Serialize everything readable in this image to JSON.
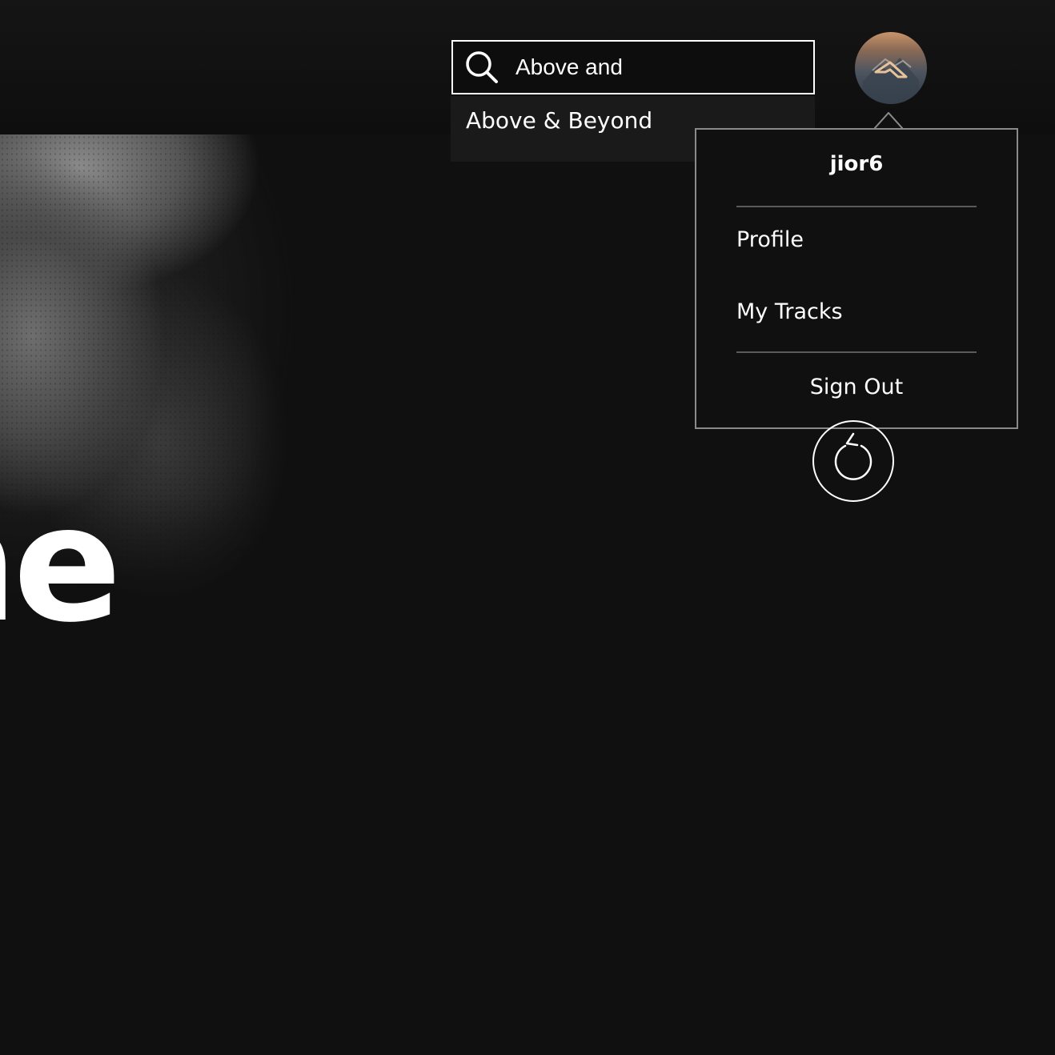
{
  "hero": {
    "title_fragment": "ne"
  },
  "search": {
    "value": "Above and",
    "placeholder": "",
    "suggestions": [
      {
        "label": "Above & Beyond"
      }
    ]
  },
  "user": {
    "avatar_icon": "anjunabeats-logo-icon",
    "menu": {
      "username": "jior6",
      "items": [
        {
          "label": "Profile"
        },
        {
          "label": "My Tracks"
        }
      ],
      "sign_out_label": "Sign Out"
    }
  },
  "controls": {
    "replay_icon": "replay-icon"
  },
  "colors": {
    "background": "#101010",
    "text": "#ffffff",
    "menu_border": "#8a8a8a",
    "divider": "#5a5a5a",
    "suggestion_bg": "#1a1a1a"
  }
}
